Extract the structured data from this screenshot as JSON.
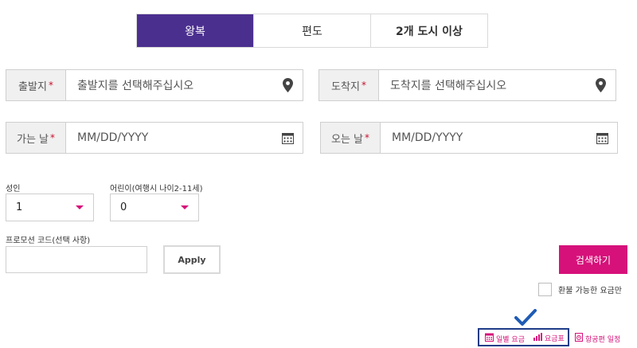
{
  "tabs": [
    {
      "label": "왕복",
      "active": true
    },
    {
      "label": "편도",
      "active": false
    },
    {
      "label": "2개 도시 이상",
      "active": false
    }
  ],
  "origin": {
    "label": "출발지",
    "required": "*",
    "placeholder": "출발지를 선택해주십시오",
    "icon": "location-pin-icon"
  },
  "destination": {
    "label": "도착지",
    "required": "*",
    "placeholder": "도착지를 선택해주십시오",
    "icon": "location-pin-icon"
  },
  "depart_date": {
    "label": "가는 날",
    "required": "*",
    "placeholder": "MM/DD/YYYY",
    "icon": "calendar-icon"
  },
  "return_date": {
    "label": "오는 날",
    "required": "*",
    "placeholder": "MM/DD/YYYY",
    "icon": "calendar-icon"
  },
  "passengers": {
    "adult": {
      "label": "성인",
      "value": "1"
    },
    "child": {
      "label": "어린이(여행시 나이2-11세)",
      "value": "0"
    }
  },
  "promo": {
    "label": "프로모션 코드(선택 사항)",
    "value": "",
    "apply_label": "Apply"
  },
  "search_label": "검색하기",
  "refundable_label": "환불 가능한 요금만",
  "links": {
    "daily_fare": "일별 요금",
    "fare_table": "요금표",
    "flight_schedule": "항공편 일정"
  },
  "colors": {
    "accent_purple": "#4b2f8f",
    "accent_magenta": "#d6117a",
    "highlight_blue": "#1f3c88",
    "check_blue": "#1f5bb5"
  }
}
